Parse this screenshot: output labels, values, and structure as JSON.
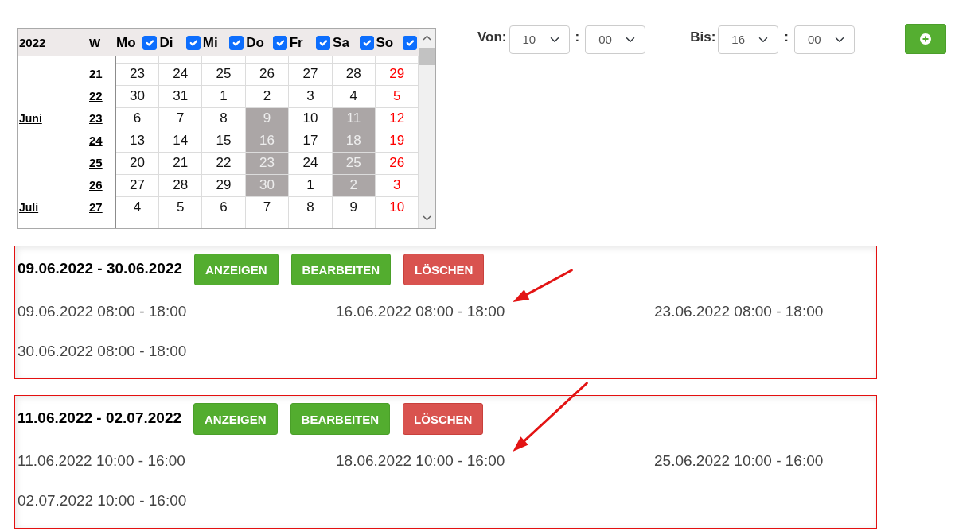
{
  "calendar": {
    "year": "2022",
    "week_heading": "W",
    "columns": [
      {
        "label": "Mo",
        "checked": true,
        "holiday": false
      },
      {
        "label": "Di",
        "checked": true,
        "holiday": false
      },
      {
        "label": "Mi",
        "checked": true,
        "holiday": false
      },
      {
        "label": "Do",
        "checked": true,
        "holiday": false
      },
      {
        "label": "Fr",
        "checked": true,
        "holiday": false
      },
      {
        "label": "Sa",
        "checked": true,
        "holiday": false
      },
      {
        "label": "So",
        "checked": true,
        "holiday": true
      }
    ],
    "month_groups": [
      {
        "label": "Juni",
        "weeks": [
          {
            "week": "21",
            "days": [
              {
                "day": "23",
                "selected": false
              },
              {
                "day": "24",
                "selected": false
              },
              {
                "day": "25",
                "selected": false
              },
              {
                "day": "26",
                "selected": false
              },
              {
                "day": "27",
                "selected": false
              },
              {
                "day": "28",
                "selected": false
              },
              {
                "day": "29",
                "selected": false
              }
            ]
          },
          {
            "week": "22",
            "days": [
              {
                "day": "30",
                "selected": false
              },
              {
                "day": "31",
                "selected": false
              },
              {
                "day": "1",
                "selected": false
              },
              {
                "day": "2",
                "selected": false
              },
              {
                "day": "3",
                "selected": false
              },
              {
                "day": "4",
                "selected": false
              },
              {
                "day": "5",
                "selected": false
              }
            ]
          },
          {
            "week": "23",
            "days": [
              {
                "day": "6",
                "selected": false
              },
              {
                "day": "7",
                "selected": false
              },
              {
                "day": "8",
                "selected": false
              },
              {
                "day": "9",
                "selected": true
              },
              {
                "day": "10",
                "selected": false
              },
              {
                "day": "11",
                "selected": true
              },
              {
                "day": "12",
                "selected": false
              }
            ]
          }
        ]
      },
      {
        "label": "Juli",
        "weeks": [
          {
            "week": "24",
            "days": [
              {
                "day": "13",
                "selected": false
              },
              {
                "day": "14",
                "selected": false
              },
              {
                "day": "15",
                "selected": false
              },
              {
                "day": "16",
                "selected": true
              },
              {
                "day": "17",
                "selected": false
              },
              {
                "day": "18",
                "selected": true
              },
              {
                "day": "19",
                "selected": false
              }
            ]
          },
          {
            "week": "25",
            "days": [
              {
                "day": "20",
                "selected": false
              },
              {
                "day": "21",
                "selected": false
              },
              {
                "day": "22",
                "selected": false
              },
              {
                "day": "23",
                "selected": true
              },
              {
                "day": "24",
                "selected": false
              },
              {
                "day": "25",
                "selected": true
              },
              {
                "day": "26",
                "selected": false
              }
            ]
          },
          {
            "week": "26",
            "days": [
              {
                "day": "27",
                "selected": false
              },
              {
                "day": "28",
                "selected": false
              },
              {
                "day": "29",
                "selected": false
              },
              {
                "day": "30",
                "selected": true
              },
              {
                "day": "1",
                "selected": false
              },
              {
                "day": "2",
                "selected": true
              },
              {
                "day": "3",
                "selected": false
              }
            ]
          },
          {
            "week": "27",
            "days": [
              {
                "day": "4",
                "selected": false
              },
              {
                "day": "5",
                "selected": false
              },
              {
                "day": "6",
                "selected": false
              },
              {
                "day": "7",
                "selected": false
              },
              {
                "day": "8",
                "selected": false
              },
              {
                "day": "9",
                "selected": false
              },
              {
                "day": "10",
                "selected": false
              }
            ]
          }
        ]
      }
    ]
  },
  "time_range": {
    "from": {
      "label": "Von:",
      "hour": "10",
      "separator": ":",
      "minute": "00"
    },
    "to": {
      "label": "Bis:",
      "hour": "16",
      "separator": ":",
      "minute": "00"
    }
  },
  "schedules": [
    {
      "title": "09.06.2022 - 30.06.2022",
      "annotated": true,
      "actions": [
        {
          "label": "ANZEIGEN",
          "kind": "show"
        },
        {
          "label": "BEARBEITEN",
          "kind": "edit"
        },
        {
          "label": "LÖSCHEN",
          "kind": "delete"
        }
      ],
      "entries": [
        "09.06.2022 08:00 - 18:00",
        "16.06.2022 08:00 - 18:00",
        "23.06.2022 08:00 - 18:00",
        "30.06.2022 08:00 - 18:00"
      ]
    },
    {
      "title": "11.06.2022 - 02.07.2022",
      "annotated": true,
      "actions": [
        {
          "label": "ANZEIGEN",
          "kind": "show"
        },
        {
          "label": "BEARBEITEN",
          "kind": "edit"
        },
        {
          "label": "LÖSCHEN",
          "kind": "delete"
        }
      ],
      "entries": [
        "11.06.2022 10:00 - 16:00",
        "18.06.2022 10:00 - 16:00",
        "25.06.2022 10:00 - 16:00",
        "02.07.2022 10:00 - 16:00"
      ]
    }
  ]
}
